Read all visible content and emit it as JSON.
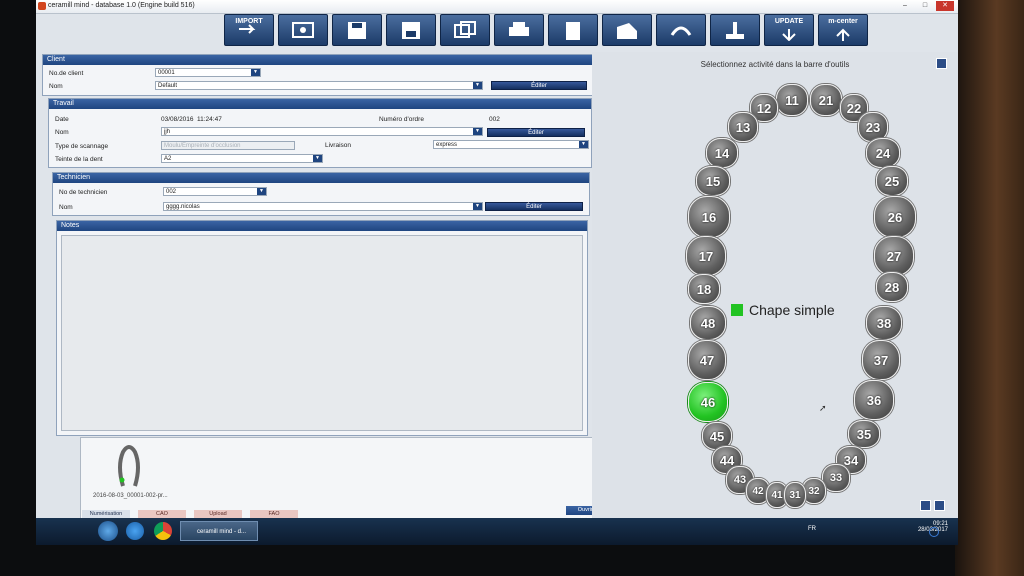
{
  "window": {
    "title": "ceramill mind - database 1.0 (Engine build 516)"
  },
  "toolbar": {
    "buttons": [
      {
        "label": "IMPORT",
        "icon": "import-arrow-icon"
      },
      {
        "label": "",
        "icon": "scan-photo-icon"
      },
      {
        "label": "",
        "icon": "save-disk-icon"
      },
      {
        "label": "",
        "icon": "save-disk-alt-icon"
      },
      {
        "label": "",
        "icon": "multi-image-icon"
      },
      {
        "label": "",
        "icon": "printer-icon"
      },
      {
        "label": "",
        "icon": "document-icon"
      },
      {
        "label": "",
        "icon": "machine-icon"
      },
      {
        "label": "",
        "icon": "teeth-icon"
      },
      {
        "label": "",
        "icon": "transfer-icon"
      },
      {
        "label": "UPDATE",
        "icon": "update-arrow-icon"
      },
      {
        "label": "m-center",
        "icon": "upload-arrow-icon"
      }
    ]
  },
  "client": {
    "section_title": "Client",
    "number_label": "No.de client",
    "number_value": "00001",
    "name_label": "Nom",
    "name_value": "Default",
    "edit_label": "Éditer"
  },
  "work": {
    "section_title": "Travail",
    "date_label": "Date",
    "date_value": "03/08/2016",
    "time_value": "11:24:47",
    "order_label": "Numéro d'ordre",
    "order_value": "002",
    "name_label": "Nom",
    "name_value": "jjh",
    "edit_label": "Éditer",
    "scan_type_label": "Type de scannage",
    "scan_type_value": "Moulu/Empreinte d'occlusion",
    "delivery_label": "Livraison",
    "delivery_value": "express",
    "shade_label": "Teinte de la dent",
    "shade_value": "A2"
  },
  "technician": {
    "section_title": "Technicien",
    "number_label": "No de technicien",
    "number_value": "002",
    "name_label": "Nom",
    "name_value": "gggg.nicolas",
    "edit_label": "Éditer"
  },
  "notes": {
    "section_title": "Notes"
  },
  "thumbnail": {
    "caption": "2016-08-03_00001-002-pr...",
    "open_label": "Ouvrir dans l'Express"
  },
  "bottom_tabs": [
    "Numérisation",
    "CAO",
    "Upload",
    "FAO"
  ],
  "tooth_panel": {
    "instruction": "Sélectionnez activité dans la barre d'outils",
    "legend_label": "Chape simple",
    "legend_color": "#22c322",
    "selected_tooth": "46",
    "teeth": [
      "11",
      "21",
      "12",
      "22",
      "13",
      "23",
      "14",
      "24",
      "15",
      "25",
      "16",
      "26",
      "17",
      "27",
      "18",
      "28",
      "48",
      "38",
      "47",
      "37",
      "46",
      "36",
      "45",
      "35",
      "44",
      "34",
      "43",
      "33",
      "42",
      "32",
      "41",
      "31"
    ]
  },
  "taskbar": {
    "app_label": "ceramill mind - d...",
    "language": "FR",
    "time": "09:21",
    "date": "28/03/2017"
  }
}
